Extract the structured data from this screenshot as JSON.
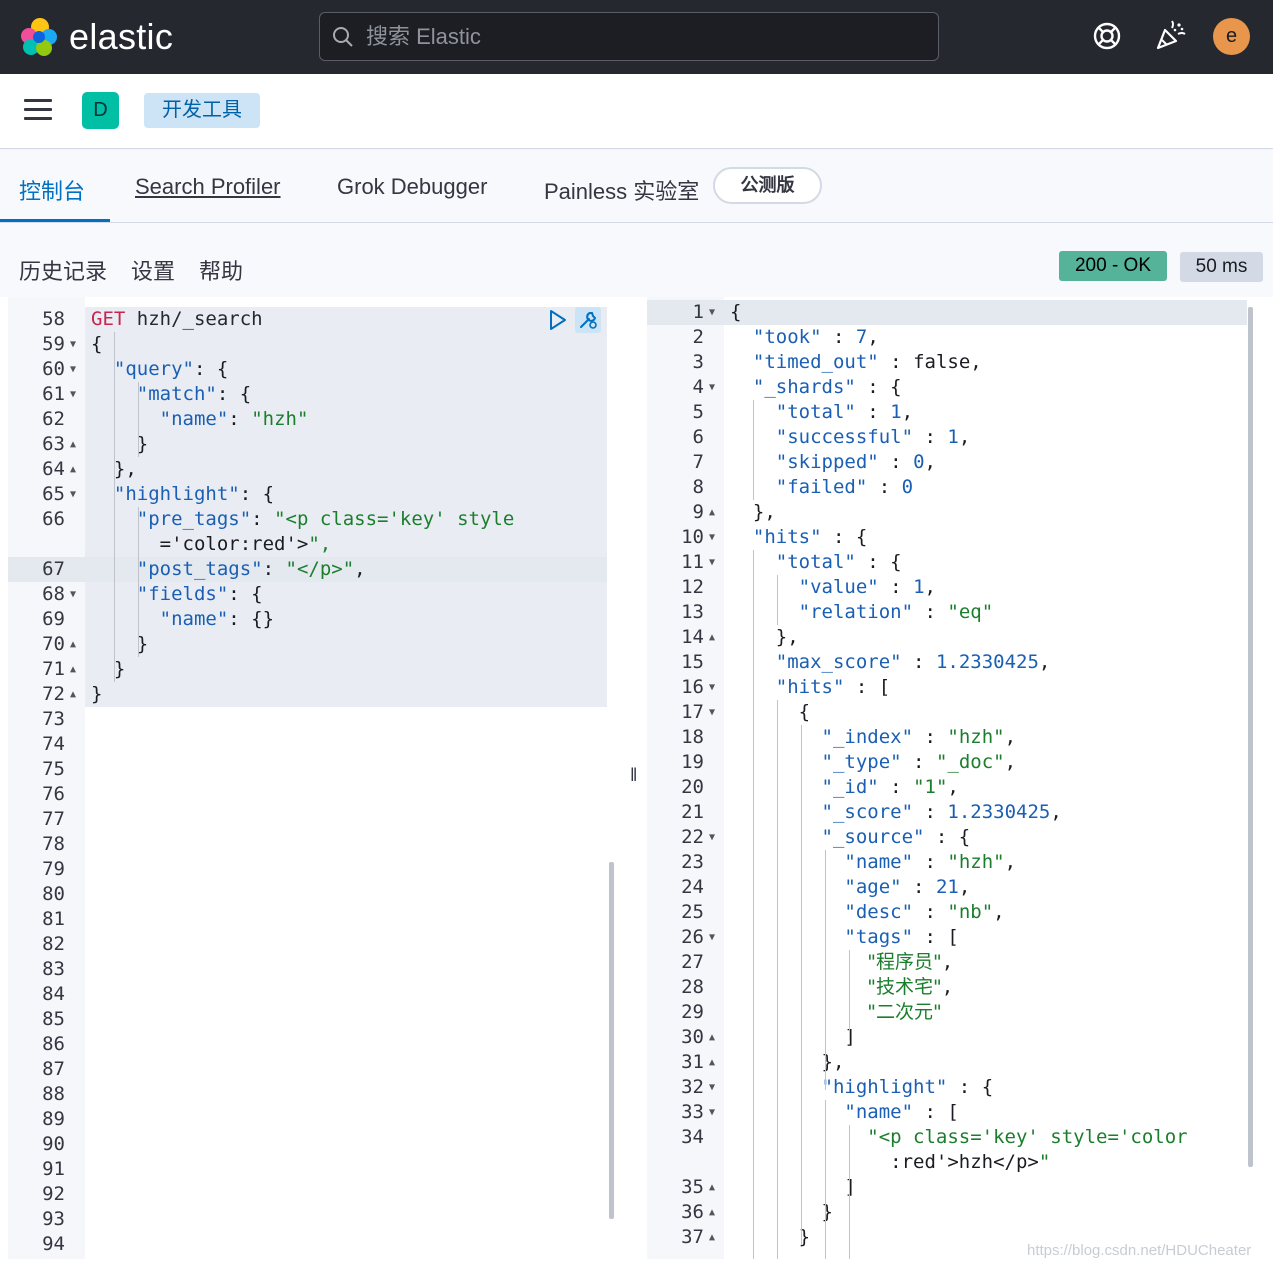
{
  "header": {
    "brand": "elastic",
    "search_placeholder": "搜索 Elastic",
    "user_initial": "e"
  },
  "subbar": {
    "space_initial": "D",
    "breadcrumb": "开发工具"
  },
  "tabs": [
    {
      "label": "控制台",
      "active": true
    },
    {
      "label": "Search Profiler"
    },
    {
      "label": "Grok Debugger"
    },
    {
      "label": "Painless 实验室"
    }
  ],
  "beta_badge": "公测版",
  "toolbar": {
    "history": "历史记录",
    "settings": "设置",
    "help": "帮助",
    "status": "200 - OK",
    "duration": "50 ms"
  },
  "request_editor": {
    "first_line": 58,
    "last_line": 94,
    "lines": [
      "GET hzh/_search",
      "{",
      "  \"query\": {",
      "    \"match\": {",
      "      \"name\": \"hzh\"",
      "    }",
      "  },",
      "  \"highlight\": {",
      "    \"pre_tags\": \"<p class='key' style",
      "      ='color:red'>\",",
      "    \"post_tags\": \"</p>\",",
      "    \"fields\": {",
      "      \"name\": {}",
      "    }",
      "  }",
      "}"
    ]
  },
  "response_editor": {
    "lines": [
      "{",
      "  \"took\" : 7,",
      "  \"timed_out\" : false,",
      "  \"_shards\" : {",
      "    \"total\" : 1,",
      "    \"successful\" : 1,",
      "    \"skipped\" : 0,",
      "    \"failed\" : 0",
      "  },",
      "  \"hits\" : {",
      "    \"total\" : {",
      "      \"value\" : 1,",
      "      \"relation\" : \"eq\"",
      "    },",
      "    \"max_score\" : 1.2330425,",
      "    \"hits\" : [",
      "      {",
      "        \"_index\" : \"hzh\",",
      "        \"_type\" : \"_doc\",",
      "        \"_id\" : \"1\",",
      "        \"_score\" : 1.2330425,",
      "        \"_source\" : {",
      "          \"name\" : \"hzh\",",
      "          \"age\" : 21,",
      "          \"desc\" : \"nb\",",
      "          \"tags\" : [",
      "            \"程序员\",",
      "            \"技术宅\",",
      "            \"二次元\"",
      "          ]",
      "        },",
      "        \"highlight\" : {",
      "          \"name\" : [",
      "            \"<p class='key' style='color",
      "              :red'>hzh</p>\"",
      "          ]",
      "        }",
      "      }"
    ]
  },
  "watermark": "https://blog.csdn.net/HDUCheater",
  "colors": {
    "topbar": "#25282f",
    "accent": "#0071c2",
    "status_ok": "#54b399",
    "space_badge": "#00bfa5",
    "avatar": "#e7964c"
  }
}
